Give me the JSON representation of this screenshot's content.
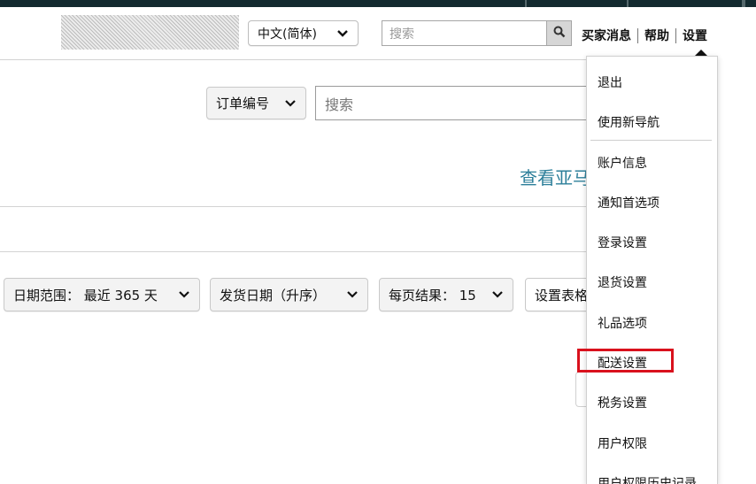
{
  "header": {
    "language_selector": "中文(简体)",
    "search_placeholder": "搜索",
    "links": [
      "买家消息",
      "帮助",
      "设置"
    ]
  },
  "orders": {
    "search_type": "订单编号",
    "search_placeholder": "搜索",
    "view_link": "查看亚马"
  },
  "filters": {
    "date_range": "日期范围： 最近 365 天",
    "sort": "发货日期（升序）",
    "per_page": "每页结果： 15",
    "table_settings": "设置表格"
  },
  "settings_menu": {
    "items": [
      "退出",
      "使用新导航",
      "账户信息",
      "通知首选项",
      "登录设置",
      "退货设置",
      "礼品选项",
      "配送设置",
      "税务设置",
      "用户权限",
      "用户权限历史记录"
    ],
    "highlighted": "配送设置"
  },
  "colors": {
    "top_bar": "#132a2f",
    "link": "#2d7f9a",
    "highlight_box": "#d9111d"
  }
}
